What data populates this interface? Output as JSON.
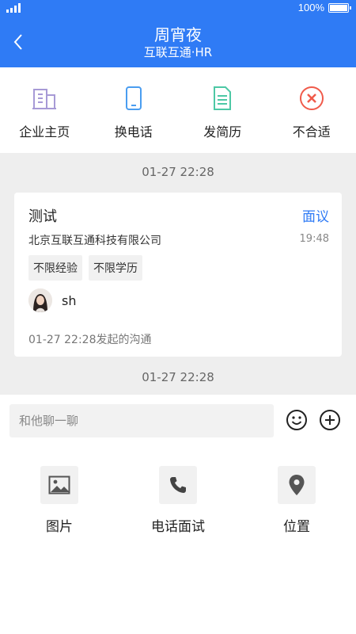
{
  "status_bar": {
    "battery": "100%"
  },
  "header": {
    "title": "周宵夜",
    "subtitle": "互联互通·HR"
  },
  "actions": [
    {
      "label": "企业主页",
      "icon": "building-icon",
      "color": "#a79ad6"
    },
    {
      "label": "换电话",
      "icon": "phone-icon",
      "color": "#4a9df0"
    },
    {
      "label": "发简历",
      "icon": "document-icon",
      "color": "#4dc8a5"
    },
    {
      "label": "不合适",
      "icon": "close-circle-icon",
      "color": "#f05a4a"
    }
  ],
  "chat": {
    "time_top": "01-27 22:28",
    "card": {
      "title": "测试",
      "link": "面议",
      "company": "北京互联互通科技有限公司",
      "time": "19:48",
      "tags": [
        "不限经验",
        "不限学历"
      ],
      "person_name": "sh",
      "footer": "01-27 22:28发起的沟通"
    },
    "time_bottom": "01-27 22:28"
  },
  "input": {
    "placeholder": "和他聊一聊"
  },
  "extras": [
    {
      "label": "图片",
      "icon": "image-icon"
    },
    {
      "label": "电话面试",
      "icon": "phone-call-icon"
    },
    {
      "label": "位置",
      "icon": "location-pin-icon"
    }
  ],
  "colors": {
    "primary": "#2f7bf5",
    "chat_bg": "#eeeeee"
  }
}
